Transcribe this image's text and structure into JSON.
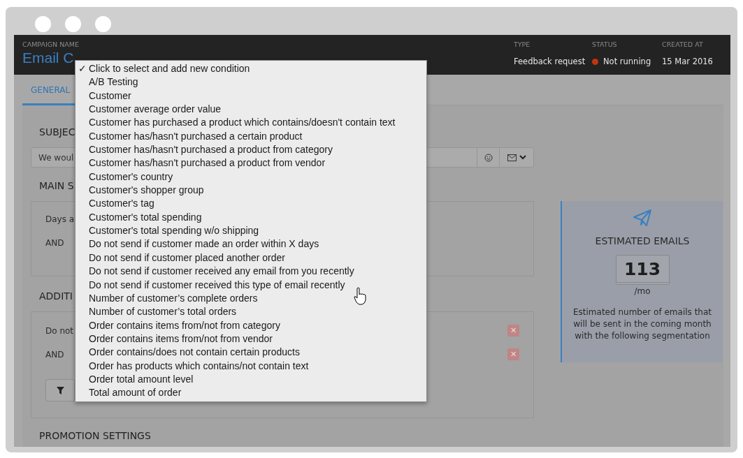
{
  "header": {
    "campaign_label": "CAMPAIGN NAME",
    "campaign_name": "Email C",
    "meta": [
      {
        "label": "TYPE",
        "value": "Feedback request",
        "kind": "text"
      },
      {
        "label": "STATUS",
        "value": "Not running",
        "kind": "status"
      },
      {
        "label": "CREATED AT",
        "value": "15 Mar 2016",
        "kind": "text"
      }
    ]
  },
  "tabs": [
    {
      "label": "GENERAL",
      "selected": true
    }
  ],
  "subject": {
    "label": "SUBJEC",
    "value": "We woul"
  },
  "main_segment": {
    "label": "MAIN S",
    "rows": [
      "Days a",
      "AND"
    ]
  },
  "additional": {
    "label": "ADDITI",
    "rows": [
      {
        "text": "Do not",
        "remove": "✕"
      },
      {
        "text": "AND",
        "remove": "✕"
      }
    ]
  },
  "promotion": {
    "label": "PROMOTION SETTINGS"
  },
  "estimate": {
    "title": "ESTIMATED EMAILS",
    "count": "113",
    "unit": "/mo",
    "note": "Estimated number of emails that will be sent in the coming month with the following segmentation"
  },
  "menu": {
    "check": "✓",
    "items": [
      {
        "label": "Click to select and add new condition",
        "selected": true
      },
      {
        "label": "A/B Testing",
        "selected": false
      },
      {
        "label": "Customer",
        "selected": false
      },
      {
        "label": "Customer average order value",
        "selected": false
      },
      {
        "label": "Customer has purchased a product which contains/doesn't contain text",
        "selected": false
      },
      {
        "label": "Customer has/hasn't purchased a certain product",
        "selected": false
      },
      {
        "label": "Customer has/hasn't purchased a product from category",
        "selected": false
      },
      {
        "label": "Customer has/hasn't purchased a product from vendor",
        "selected": false
      },
      {
        "label": "Customer's country",
        "selected": false
      },
      {
        "label": "Customer's shopper group",
        "selected": false
      },
      {
        "label": "Customer's tag",
        "selected": false
      },
      {
        "label": "Customer's total spending",
        "selected": false
      },
      {
        "label": "Customer's total spending w/o shipping",
        "selected": false
      },
      {
        "label": "Do not send if customer made an order within X days",
        "selected": false
      },
      {
        "label": "Do not send if customer placed another order",
        "selected": false
      },
      {
        "label": "Do not send if customer received any email from you recently",
        "selected": false
      },
      {
        "label": "Do not send if customer received this type of email recently",
        "selected": false
      },
      {
        "label": "Number of customer’s complete orders",
        "selected": false
      },
      {
        "label": "Number of customer’s total orders",
        "selected": false
      },
      {
        "label": "Order contains items from/not from category",
        "selected": false
      },
      {
        "label": "Order contains items from/not from vendor",
        "selected": false
      },
      {
        "label": "Order contains/does not contain certain products",
        "selected": false
      },
      {
        "label": "Order has products which contains/not contain text",
        "selected": false
      },
      {
        "label": "Order total amount level",
        "selected": false
      },
      {
        "label": "Total amount of order",
        "selected": false
      }
    ]
  }
}
